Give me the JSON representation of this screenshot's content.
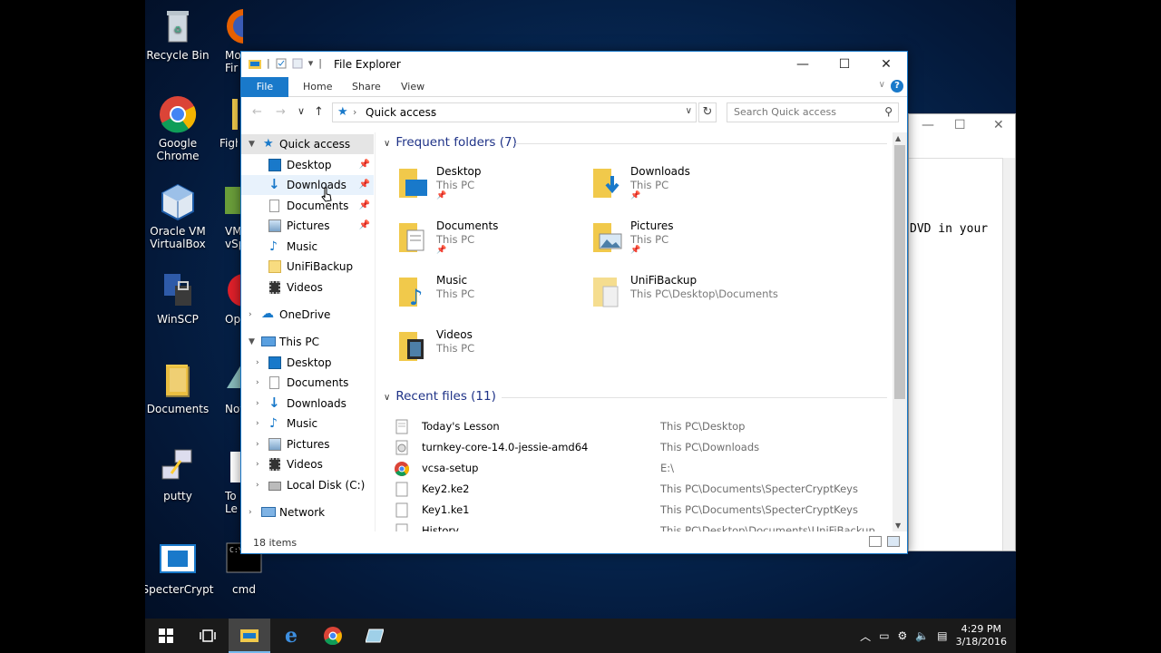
{
  "desktop": {
    "icons": [
      {
        "label_1": "Recycle Bin",
        "label_2": ""
      },
      {
        "label_1": "Google",
        "label_2": "Chrome"
      },
      {
        "label_1": "Oracle VM",
        "label_2": "VirtualBox"
      },
      {
        "label_1": "WinSCP",
        "label_2": ""
      },
      {
        "label_1": "Documents",
        "label_2": ""
      },
      {
        "label_1": "putty",
        "label_2": ""
      },
      {
        "label_1": "SpecterCrypt",
        "label_2": ""
      },
      {
        "label_1": "cmd",
        "label_2": ""
      }
    ],
    "partial_icons": [
      {
        "label_1": "Mo",
        "label_2": "Fir"
      },
      {
        "label_1": "Figh",
        "label_2": ""
      },
      {
        "label_1": "VM",
        "label_2": "vSp"
      },
      {
        "label_1": "Op",
        "label_2": ""
      },
      {
        "label_1": "Not",
        "label_2": ""
      },
      {
        "label_1": "To",
        "label_2": "Le"
      }
    ]
  },
  "background_window": {
    "text": "DVD in your"
  },
  "explorer": {
    "title": "File Explorer",
    "ribbon_tabs": {
      "file": "File",
      "home": "Home",
      "share": "Share",
      "view": "View"
    },
    "help": "?",
    "address": {
      "location": "Quick access"
    },
    "search_placeholder": "Search Quick access",
    "nav": {
      "quick_access": "Quick access",
      "qa_items": [
        "Desktop",
        "Downloads",
        "Documents",
        "Pictures",
        "Music",
        "UniFiBackup",
        "Videos"
      ],
      "onedrive": "OneDrive",
      "this_pc": "This PC",
      "pc_items": [
        "Desktop",
        "Documents",
        "Downloads",
        "Music",
        "Pictures",
        "Videos",
        "Local Disk (C:)"
      ],
      "network": "Network"
    },
    "frequent_header": "Frequent folders (7)",
    "frequent": [
      {
        "name": "Desktop",
        "location": "This PC",
        "pinned": true
      },
      {
        "name": "Downloads",
        "location": "This PC",
        "pinned": true
      },
      {
        "name": "Documents",
        "location": "This PC",
        "pinned": true
      },
      {
        "name": "Pictures",
        "location": "This PC",
        "pinned": true
      },
      {
        "name": "Music",
        "location": "This PC",
        "pinned": false
      },
      {
        "name": "UniFiBackup",
        "location": "This PC\\Desktop\\Documents",
        "pinned": false
      },
      {
        "name": "Videos",
        "location": "This PC",
        "pinned": false
      }
    ],
    "recent_header": "Recent files (11)",
    "recent": [
      {
        "name": "Today's Lesson",
        "path": "This PC\\Desktop"
      },
      {
        "name": "turnkey-core-14.0-jessie-amd64",
        "path": "This PC\\Downloads"
      },
      {
        "name": "vcsa-setup",
        "path": "E:\\"
      },
      {
        "name": "Key2.ke2",
        "path": "This PC\\Documents\\SpecterCryptKeys"
      },
      {
        "name": "Key1.ke1",
        "path": "This PC\\Documents\\SpecterCryptKeys"
      },
      {
        "name": "History",
        "path": "This PC\\Desktop\\Documents\\UniFiBackup"
      }
    ],
    "status": "18 items"
  },
  "taskbar": {
    "time": "4:29 PM",
    "date": "3/18/2016"
  },
  "colors": {
    "accent": "#1979ca",
    "folder": "#f1c94b",
    "group_header": "#1e3287"
  }
}
